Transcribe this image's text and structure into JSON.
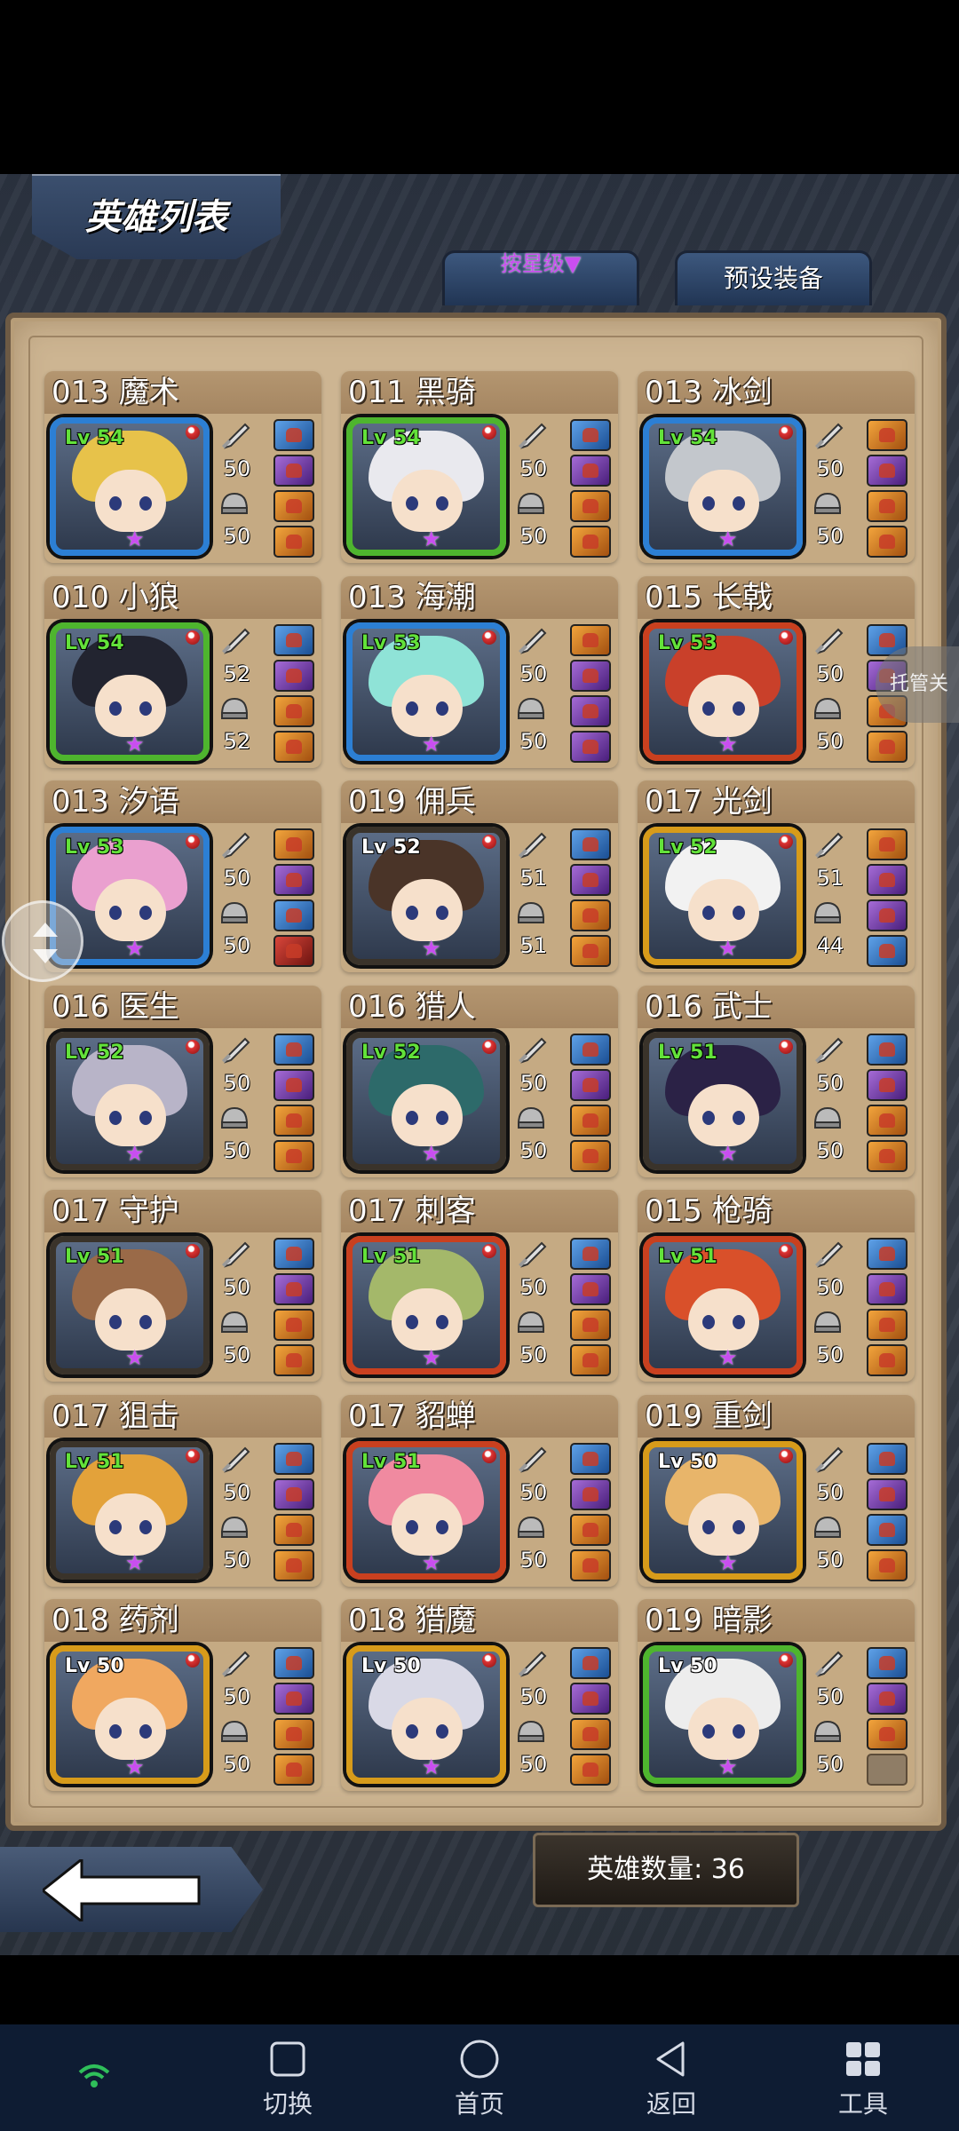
{
  "header": {
    "title": "英雄列表",
    "sort_label": "按星级▼",
    "preset_label": "预设装备"
  },
  "side": {
    "managed_label": "托管关"
  },
  "footer": {
    "count_label": "英雄数量: 36"
  },
  "heroes": [
    {
      "name": "013 魔术",
      "level": "Lv 54",
      "lv_color": "green",
      "frame": "blue",
      "hair": "#e7c24a",
      "atk": "50",
      "def": "50",
      "slots": [
        "blue",
        "purple",
        "orange",
        "orange"
      ]
    },
    {
      "name": "011 黑骑",
      "level": "Lv 54",
      "lv_color": "green",
      "frame": "green",
      "hair": "#e9e9ee",
      "atk": "50",
      "def": "50",
      "slots": [
        "blue",
        "purple",
        "orange",
        "orange"
      ]
    },
    {
      "name": "013 冰剑",
      "level": "Lv 54",
      "lv_color": "green",
      "frame": "blue",
      "hair": "#c3c7cc",
      "atk": "50",
      "def": "50",
      "slots": [
        "orange",
        "purple",
        "orange",
        "orange"
      ]
    },
    {
      "name": "010 小狼",
      "level": "Lv 54",
      "lv_color": "green",
      "frame": "green",
      "hair": "#222430",
      "atk": "52",
      "def": "52",
      "slots": [
        "blue",
        "purple",
        "orange",
        "orange"
      ]
    },
    {
      "name": "013 海潮",
      "level": "Lv 53",
      "lv_color": "green",
      "frame": "blue",
      "hair": "#8fe3d7",
      "atk": "50",
      "def": "50",
      "slots": [
        "orange",
        "purple",
        "purple",
        "purple"
      ]
    },
    {
      "name": "015 长戟",
      "level": "Lv 53",
      "lv_color": "green",
      "frame": "red",
      "hair": "#c9402a",
      "atk": "50",
      "def": "50",
      "slots": [
        "blue",
        "purple",
        "orange",
        "orange"
      ]
    },
    {
      "name": "013 汐语",
      "level": "Lv 53",
      "lv_color": "green",
      "frame": "blue",
      "hair": "#eaa0cf",
      "atk": "50",
      "def": "50",
      "slots": [
        "orange",
        "purple",
        "blue",
        "red"
      ]
    },
    {
      "name": "019 佣兵",
      "level": "Lv 52",
      "lv_color": "white",
      "frame": "dark",
      "hair": "#4a3428",
      "atk": "51",
      "def": "51",
      "slots": [
        "blue",
        "purple",
        "orange",
        "orange"
      ]
    },
    {
      "name": "017 光剑",
      "level": "Lv 52",
      "lv_color": "green",
      "frame": "gold",
      "hair": "#f2f2f2",
      "atk": "51",
      "def": "44",
      "slots": [
        "orange",
        "purple",
        "purple",
        "blue"
      ]
    },
    {
      "name": "016 医生",
      "level": "Lv 52",
      "lv_color": "green",
      "frame": "dark",
      "hair": "#b8b4c8",
      "atk": "50",
      "def": "50",
      "slots": [
        "blue",
        "purple",
        "orange",
        "orange"
      ]
    },
    {
      "name": "016 猎人",
      "level": "Lv 52",
      "lv_color": "green",
      "frame": "dark",
      "hair": "#2d6a6a",
      "atk": "50",
      "def": "50",
      "slots": [
        "blue",
        "purple",
        "orange",
        "orange"
      ]
    },
    {
      "name": "016 武士",
      "level": "Lv 51",
      "lv_color": "green",
      "frame": "dark",
      "hair": "#2b2246",
      "atk": "50",
      "def": "50",
      "slots": [
        "blue",
        "purple",
        "orange",
        "orange"
      ]
    },
    {
      "name": "017 守护",
      "level": "Lv 51",
      "lv_color": "green",
      "frame": "dark",
      "hair": "#9a6a48",
      "atk": "50",
      "def": "50",
      "slots": [
        "blue",
        "purple",
        "orange",
        "orange"
      ]
    },
    {
      "name": "017 刺客",
      "level": "Lv 51",
      "lv_color": "green",
      "frame": "red",
      "hair": "#a4b86a",
      "atk": "50",
      "def": "50",
      "slots": [
        "blue",
        "purple",
        "orange",
        "orange"
      ]
    },
    {
      "name": "015 枪骑",
      "level": "Lv 51",
      "lv_color": "green",
      "frame": "red",
      "hair": "#d9502a",
      "atk": "50",
      "def": "50",
      "slots": [
        "blue",
        "purple",
        "orange",
        "orange"
      ]
    },
    {
      "name": "017 狙击",
      "level": "Lv 51",
      "lv_color": "green",
      "frame": "dark",
      "hair": "#e3a23a",
      "atk": "50",
      "def": "50",
      "slots": [
        "blue",
        "purple",
        "orange",
        "orange"
      ]
    },
    {
      "name": "017 貂蝉",
      "level": "Lv 51",
      "lv_color": "green",
      "frame": "red",
      "hair": "#f08aa0",
      "atk": "50",
      "def": "50",
      "slots": [
        "blue",
        "purple",
        "orange",
        "orange"
      ]
    },
    {
      "name": "019 重剑",
      "level": "Lv 50",
      "lv_color": "white",
      "frame": "gold",
      "hair": "#e8b56a",
      "atk": "50",
      "def": "50",
      "slots": [
        "blue",
        "purple",
        "blue",
        "orange"
      ]
    },
    {
      "name": "018 药剂",
      "level": "Lv 50",
      "lv_color": "white",
      "frame": "gold",
      "hair": "#f0a860",
      "atk": "50",
      "def": "50",
      "slots": [
        "blue",
        "purple",
        "orange",
        "orange"
      ]
    },
    {
      "name": "018 猎魔",
      "level": "Lv 50",
      "lv_color": "white",
      "frame": "gold",
      "hair": "#d9d9e6",
      "atk": "50",
      "def": "50",
      "slots": [
        "blue",
        "purple",
        "orange",
        "orange"
      ]
    },
    {
      "name": "019 暗影",
      "level": "Lv 50",
      "lv_color": "white",
      "frame": "green",
      "hair": "#ededed",
      "atk": "50",
      "def": "50",
      "slots": [
        "blue",
        "purple",
        "orange",
        "empty"
      ]
    }
  ],
  "navbar": {
    "switch_label": "切换",
    "home_label": "首页",
    "back_label": "返回",
    "tools_label": "工具"
  }
}
